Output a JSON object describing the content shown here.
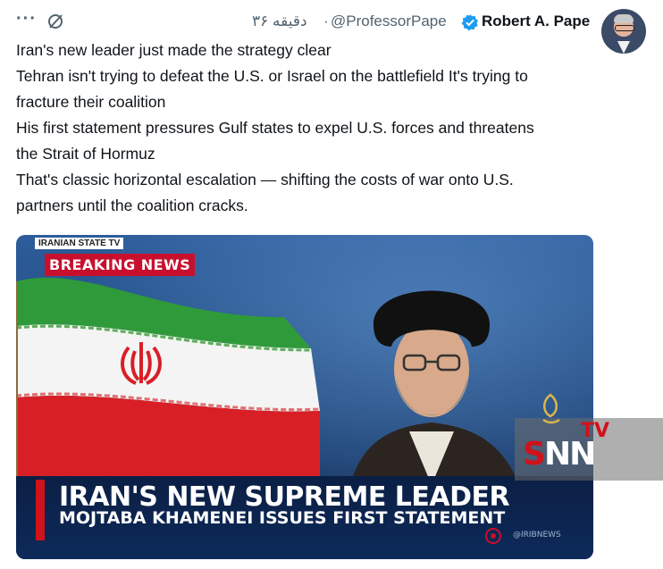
{
  "header": {
    "more_label": "···",
    "time": "۳۶ دقیقه",
    "separator": "·",
    "handle": "@ProfessorPape",
    "name": "Robert A. Pape"
  },
  "tweet": {
    "lines": [
      "Iran's new leader just made the strategy clear",
      "Tehran isn't trying to defeat the U.S. or Israel on the battlefield   It's trying to",
      "fracture their coalition",
      "His first statement pressures Gulf states to expel U.S. forces and threatens",
      "the Strait of Hormuz",
      "That's classic horizontal escalation — shifting the costs of war onto U.S.",
      "partners until the coalition cracks."
    ]
  },
  "media": {
    "state_tag": "IRANIAN STATE TV",
    "breaking": "BREAKING NEWS",
    "headline_1": "IRAN'S NEW SUPREME LEADER",
    "headline_2": "MOJTABA KHAMENEI ISSUES FIRST STATEMENT",
    "credit": "@IRIBNEWS",
    "watermark_snn": "SNN",
    "watermark_tv": "TV"
  },
  "colors": {
    "verified": "#1d9bf0",
    "breaking_red": "#c8102e",
    "flag_green": "#2f9a3a",
    "flag_red": "#d81f26",
    "text": "#0f1419",
    "muted": "#536471"
  },
  "icons": [
    "more-icon",
    "grok-icon",
    "verified-badge-icon",
    "al-jazeera-logo-icon",
    "iribnews-logo-icon"
  ]
}
